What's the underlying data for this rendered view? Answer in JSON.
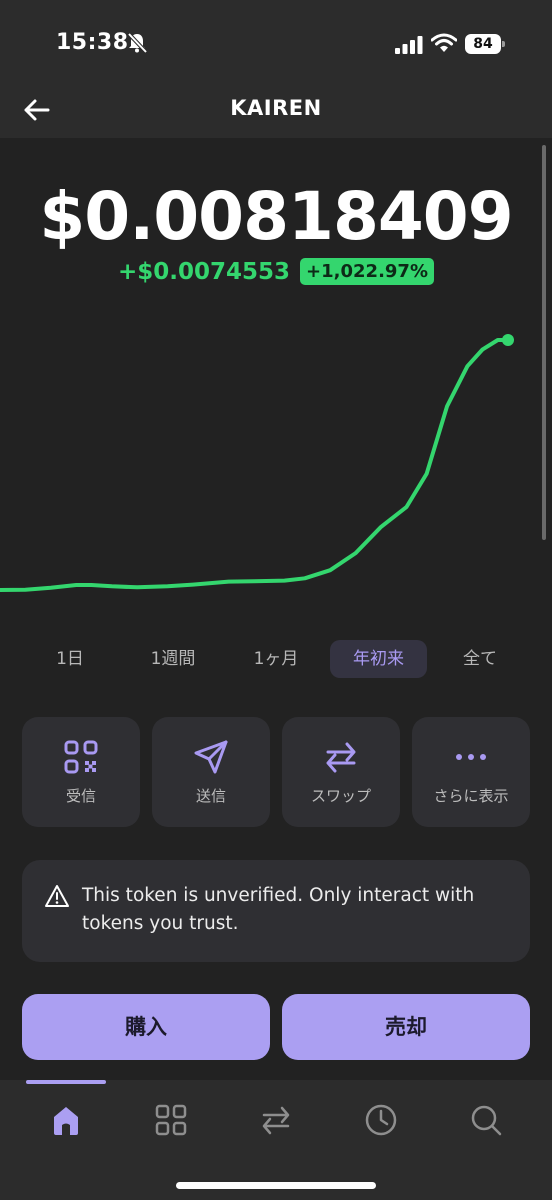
{
  "status_bar": {
    "time": "15:38",
    "battery": "84"
  },
  "header": {
    "title": "KAIREN"
  },
  "price": {
    "value": "$0.00818409",
    "change_abs": "+$0.0074553",
    "change_pct": "+1,022.97%"
  },
  "chart_data": {
    "type": "line",
    "title": "",
    "xlabel": "",
    "ylabel": "",
    "x": [
      0,
      0.05,
      0.1,
      0.15,
      0.18,
      0.22,
      0.27,
      0.33,
      0.38,
      0.45,
      0.5,
      0.56,
      0.6,
      0.65,
      0.7,
      0.75,
      0.8,
      0.84,
      0.88,
      0.92,
      0.95,
      0.98,
      1.0
    ],
    "values": [
      0.00073,
      0.00074,
      0.0008,
      0.00088,
      0.00088,
      0.00084,
      0.00081,
      0.00084,
      0.00089,
      0.00098,
      0.00099,
      0.00101,
      0.00108,
      0.00132,
      0.00183,
      0.00261,
      0.0032,
      0.0042,
      0.0062,
      0.0074,
      0.0079,
      0.00818,
      0.00818
    ],
    "series": [
      {
        "values": []
      }
    ],
    "color": "#34d66e",
    "grid": false,
    "legend": "none"
  },
  "timeframes": {
    "selected": "年初来",
    "items": [
      "1日",
      "1週間",
      "1ヶ月",
      "年初来",
      "全て"
    ]
  },
  "actions": {
    "receive": "受信",
    "send": "送信",
    "swap": "スワップ",
    "more": "さらに表示"
  },
  "warning": {
    "text": "This token is unverified. Only interact with tokens you trust."
  },
  "trade": {
    "buy": "購入",
    "sell": "売却"
  },
  "nav": {
    "icons": [
      "home-icon",
      "grid-icon",
      "swap-icon",
      "clock-icon",
      "search-icon"
    ],
    "active": "home"
  },
  "colors": {
    "accent": "#ab9ff2",
    "positive": "#34d66e",
    "background": "#222222",
    "card": "#2f2f33"
  }
}
